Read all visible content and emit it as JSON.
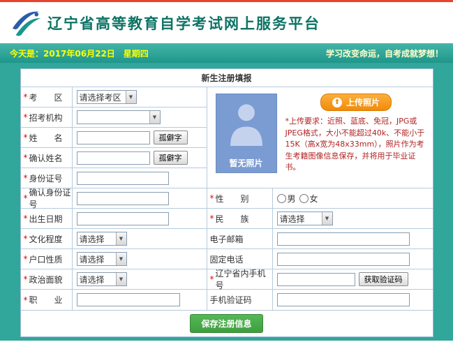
{
  "header": {
    "title": "辽宁省高等教育自学考试网上服务平台"
  },
  "info_bar": {
    "date": "今天是：2017年06月22日　星期四",
    "slogan": "学习改变命运，自考成就梦想！"
  },
  "icons": {
    "chevron_down": "▼",
    "upload_arrow": "⬆"
  },
  "form": {
    "title": "新生注册填报",
    "required_mark": "*",
    "fields": {
      "exam_area": {
        "label": "考　　区",
        "value": "请选择考区"
      },
      "recruit_org": {
        "label": "招考机构",
        "value": ""
      },
      "name": {
        "label": "姓　　名",
        "value": "",
        "button": "孤僻字"
      },
      "confirm_name": {
        "label": "确认姓名",
        "value": "",
        "button": "孤僻字"
      },
      "id_number": {
        "label": "身份证号",
        "value": ""
      },
      "confirm_id": {
        "label": "确认身份证号",
        "value": ""
      },
      "birth_date": {
        "label": "出生日期",
        "value": ""
      },
      "education": {
        "label": "文化程度",
        "value": "请选择"
      },
      "household": {
        "label": "户口性质",
        "value": "请选择"
      },
      "political": {
        "label": "政治面貌",
        "value": "请选择"
      },
      "occupation": {
        "label": "职　　业",
        "value": ""
      },
      "gender": {
        "label": "性　　别",
        "options": [
          "男",
          "女"
        ]
      },
      "ethnicity": {
        "label": "民　　族",
        "value": "请选择"
      },
      "email": {
        "label": "电子邮箱",
        "value": ""
      },
      "landline": {
        "label": "固定电话",
        "value": ""
      },
      "mobile": {
        "label": "辽宁省内手机号",
        "value": "",
        "button": "获取验证码"
      },
      "sms_code": {
        "label": "手机验证码",
        "value": ""
      }
    },
    "photo": {
      "placeholder_text": "暂无照片",
      "upload_button": "上传照片",
      "requirements": "*上传要求：近照、蓝底、免冠，JPG或JPEG格式，大小不能超过40k、不能小于15K（高x宽为48x33mm），照片作为考生考籍图像信息保存，并将用于毕业证书。"
    },
    "save_button": "保存注册信息"
  },
  "colors": {
    "top_line_red": "#e8432d",
    "header_title_teal": "#0d7365",
    "page_teal": "#31a69a",
    "date_yellow": "#ffff00",
    "photo_blue": "#7b9cd2",
    "upload_orange": "#f28a0a",
    "requirement_red": "#b22222",
    "save_green": "#4cae4c",
    "table_border_blue": "#b6cbdf"
  }
}
